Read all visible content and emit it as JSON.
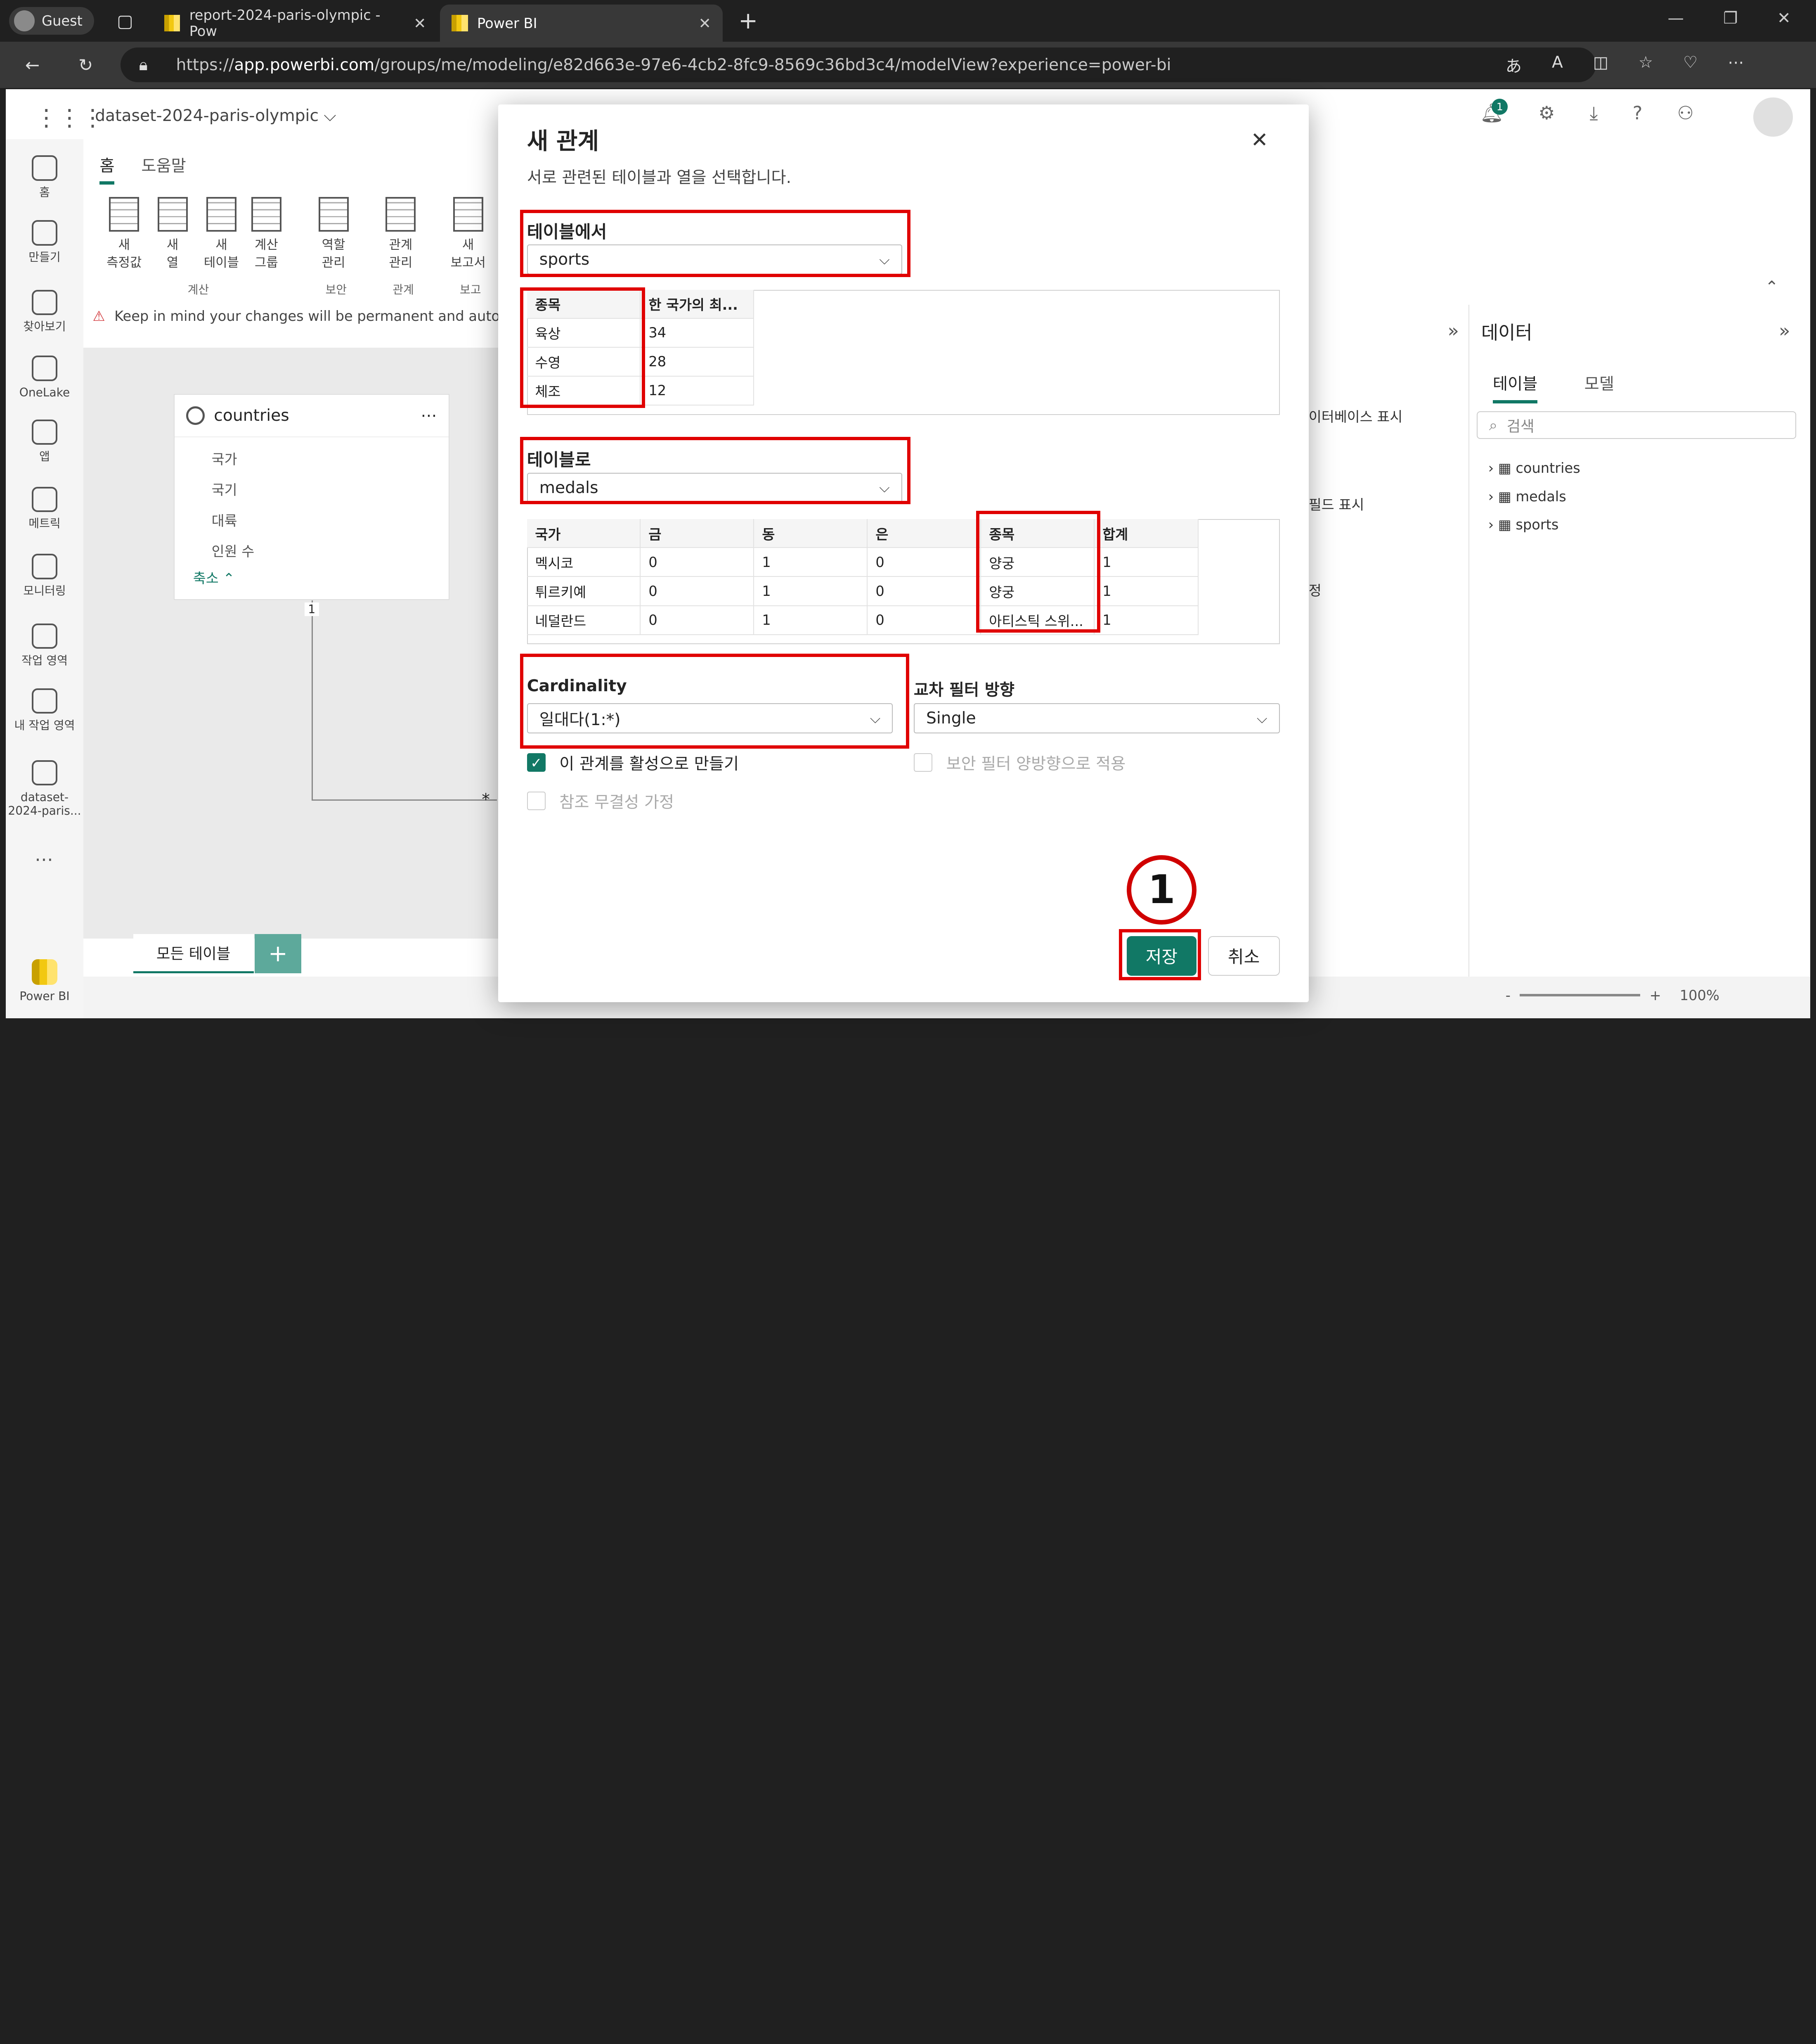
{
  "browser": {
    "guest": "Guest",
    "tabs": [
      "report-2024-paris-olympic - Pow",
      "Power BI"
    ],
    "url_prefix": "https://",
    "url_domain": "app.powerbi.com",
    "url_rest": "/groups/me/modeling/e82d663e-97e6-4cb2-8fc9-8569c36bd3c4/modelView?experience=power-bi"
  },
  "app": {
    "dataset": "dataset-2024-paris-olympic",
    "ribbon_tabs": [
      "홈",
      "도움말"
    ],
    "ribbon_buttons": [
      "새\n측정값",
      "새\n열",
      "새\n테이블",
      "계산\n그룹",
      "역할\n관리",
      "관계\n관리",
      "새\n보고서"
    ],
    "ribbon_groups": [
      "계산",
      "보안",
      "관계",
      "보고"
    ],
    "warning": "Keep in mind your changes will be permanent and automat",
    "nav": [
      "홈",
      "만들기",
      "찾아보기",
      "OneLake",
      "앱",
      "메트릭",
      "모니터링",
      "작업 영역",
      "내 작업 영역",
      "dataset-\n2024-paris...",
      "Power BI"
    ],
    "countries_card": {
      "title": "countries",
      "fields": [
        "국가",
        "국기",
        "대륙",
        "인원 수"
      ],
      "collapse": "축소"
    },
    "bottom_tab": "모든 테이블",
    "zoom": "100%"
  },
  "data_pane": {
    "title": "데이터",
    "tabs": [
      "테이블",
      "모델"
    ],
    "search_placeholder": "검색",
    "tables": [
      "countries",
      "medals",
      "sports"
    ]
  },
  "prop_fragments": [
    "이터베이스 표시",
    "필드 표시",
    "정"
  ],
  "dialog": {
    "title": "새 관계",
    "subtitle": "서로 관련된 테이블과 열을 선택합니다.",
    "from_label": "테이블에서",
    "from_value": "sports",
    "from_headers": [
      "종목",
      "한 국가의 최..."
    ],
    "from_rows": [
      [
        "육상",
        "34"
      ],
      [
        "수영",
        "28"
      ],
      [
        "체조",
        "12"
      ]
    ],
    "to_label": "테이블로",
    "to_value": "medals",
    "to_headers": [
      "국가",
      "금",
      "동",
      "은",
      "종목",
      "합계"
    ],
    "to_rows": [
      [
        "멕시코",
        "0",
        "1",
        "0",
        "양궁",
        "1"
      ],
      [
        "튀르키예",
        "0",
        "1",
        "0",
        "양궁",
        "1"
      ],
      [
        "네덜란드",
        "0",
        "1",
        "0",
        "아티스틱 스위...",
        "1"
      ]
    ],
    "cardinality_label": "Cardinality",
    "cardinality_value": "일대다(1:*)",
    "filter_label": "교차 필터 방향",
    "filter_value": "Single",
    "chk_active": "이 관계를 활성으로 만들기",
    "chk_security": "보안 필터 양방향으로 적용",
    "chk_integrity": "참조 무결성 가정",
    "save": "저장",
    "cancel": "취소",
    "step": "1"
  }
}
